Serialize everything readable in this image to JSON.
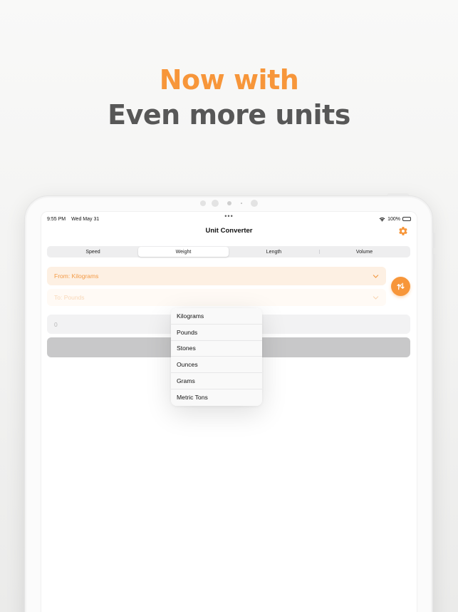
{
  "headline": {
    "line1": "Now with",
    "line2": "Even more units"
  },
  "status_bar": {
    "time": "9:55 PM",
    "date": "Wed May 31",
    "dots": "•••",
    "battery": "100%"
  },
  "nav": {
    "title": "Unit Converter"
  },
  "segments": [
    "Speed",
    "Weight",
    "Length",
    "Volume"
  ],
  "selected_segment": "Weight",
  "from": {
    "label": "From: Kilograms"
  },
  "to": {
    "label": "To: Pounds"
  },
  "input": {
    "value": "0"
  },
  "dropdown": {
    "options": [
      "Kilograms",
      "Pounds",
      "Stones",
      "Ounces",
      "Grams",
      "Metric Tons"
    ]
  },
  "colors": {
    "accent": "#f7963a",
    "headline_gray": "#575757"
  }
}
